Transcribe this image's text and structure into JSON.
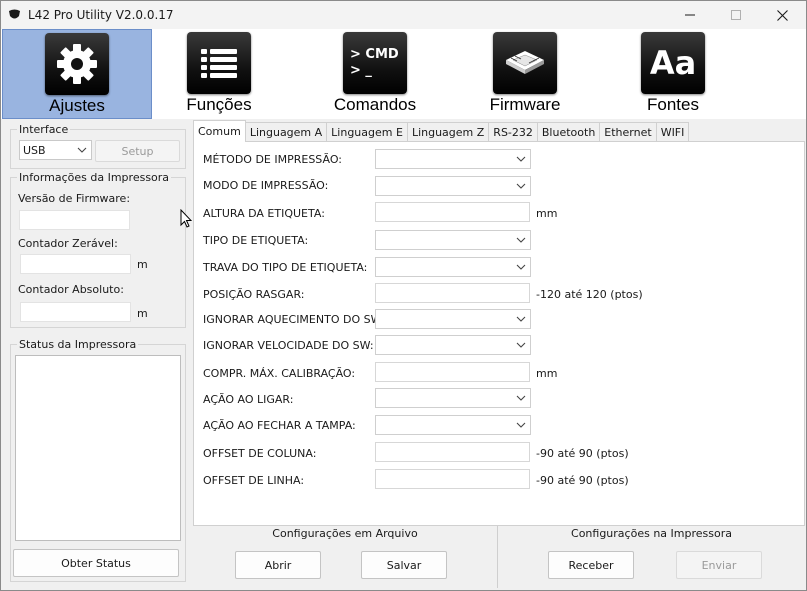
{
  "window": {
    "title": "L42 Pro Utility  V2.0.0.17"
  },
  "toolbar": {
    "items": [
      {
        "label": "Ajustes",
        "icon": "gear-icon",
        "active": true
      },
      {
        "label": "Funções",
        "icon": "list-icon",
        "active": false
      },
      {
        "label": "Comandos",
        "icon": "terminal-icon",
        "active": false,
        "icon_text": "> CMD"
      },
      {
        "label": "Firmware",
        "icon": "chip-icon",
        "active": false
      },
      {
        "label": "Fontes",
        "icon": "font-icon",
        "active": false,
        "icon_text": "Aa"
      }
    ]
  },
  "interface": {
    "title": "Interface",
    "selected": "USB",
    "setup_label": "Setup"
  },
  "printer_info": {
    "title": "Informações da Impressora",
    "firmware_label": "Versão de Firmware:",
    "firmware_value": "",
    "resettable_counter_label": "Contador Zerável:",
    "resettable_counter_value": "",
    "resettable_counter_unit": "m",
    "absolute_counter_label": "Contador Absoluto:",
    "absolute_counter_value": "",
    "absolute_counter_unit": "m"
  },
  "printer_status": {
    "title": "Status da Impressora",
    "get_status_label": "Obter Status"
  },
  "tabs": [
    "Comum",
    "Linguagem A",
    "Linguagem E",
    "Linguagem Z",
    "RS-232",
    "Bluetooth",
    "Ethernet",
    "WIFI"
  ],
  "active_tab": "Comum",
  "settings": {
    "metodo_impressao": {
      "label": "MÉTODO DE IMPRESSÃO:",
      "value": ""
    },
    "modo_impressao": {
      "label": "MODO DE IMPRESSÃO:",
      "value": ""
    },
    "altura_etiqueta": {
      "label": "ALTURA DA ETIQUETA:",
      "value": "",
      "unit": "mm"
    },
    "tipo_etiqueta": {
      "label": "TIPO DE ETIQUETA:",
      "value": ""
    },
    "trava_tipo_etiqueta": {
      "label": "TRAVA DO TIPO DE ETIQUETA:",
      "value": ""
    },
    "posicao_rasgar": {
      "label": "POSIÇÃO RASGAR:",
      "value": "",
      "unit": "-120 até 120 (ptos)"
    },
    "ignorar_aquecimento": {
      "label": "IGNORAR AQUECIMENTO DO SW:",
      "value": ""
    },
    "ignorar_velocidade": {
      "label": "IGNORAR VELOCIDADE DO SW:",
      "value": ""
    },
    "compr_max_calibracao": {
      "label": "COMPR. MÁX. CALIBRAÇÃO:",
      "value": "",
      "unit": "mm"
    },
    "acao_ao_ligar": {
      "label": "AÇÃO AO LIGAR:",
      "value": ""
    },
    "acao_fechar_tampa": {
      "label": "AÇÃO AO FECHAR A TAMPA:",
      "value": ""
    },
    "offset_coluna": {
      "label": "OFFSET DE COLUNA:",
      "value": "",
      "unit": "-90 até 90 (ptos)"
    },
    "offset_linha": {
      "label": "OFFSET DE LINHA:",
      "value": "",
      "unit": "-90 até 90 (ptos)"
    }
  },
  "file_config": {
    "title": "Configurações em Arquivo",
    "open_label": "Abrir",
    "save_label": "Salvar"
  },
  "printer_config": {
    "title": "Configurações na Impressora",
    "receive_label": "Receber",
    "send_label": "Enviar"
  }
}
